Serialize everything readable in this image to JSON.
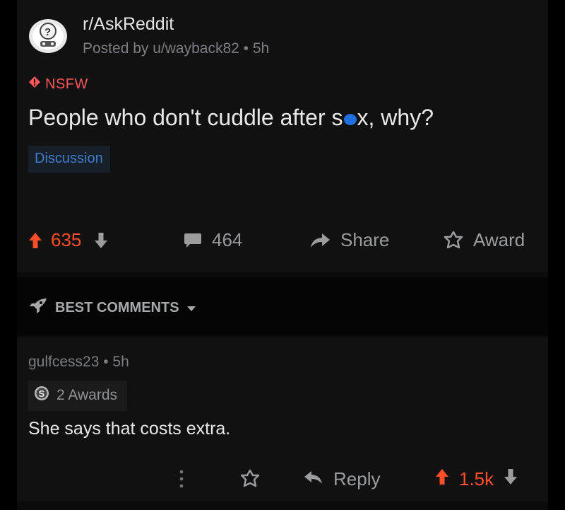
{
  "post": {
    "subreddit": "r/AskReddit",
    "posted_by": "Posted by u/wayback82 • 5h",
    "nsfw_label": "NSFW",
    "title": "People who don't cuddle after s•x, why?",
    "flair": "Discussion",
    "score": "635",
    "comment_count": "464",
    "share_label": "Share",
    "award_label": "Award"
  },
  "sort": {
    "label": "BEST COMMENTS"
  },
  "comment": {
    "author_line": "gulfcess23 • 5h",
    "awards": "2 Awards",
    "body": "She says that costs extra.",
    "reply_label": "Reply",
    "score": "1.5k"
  },
  "colors": {
    "upvote_orange": "#ff4f2a",
    "nsfw_red": "#ff585b",
    "flair_blue": "#3f7ccc",
    "censor_blue": "#1f6fe0",
    "muted_gray": "#9a9c9e"
  },
  "icons": [
    "subreddit-avatar-icon",
    "nsfw-icon",
    "upvote-icon",
    "downvote-icon",
    "comment-icon",
    "share-icon",
    "award-icon",
    "rocket-icon",
    "chevron-down-icon",
    "silver-award-icon",
    "more-options-icon",
    "reply-icon"
  ]
}
